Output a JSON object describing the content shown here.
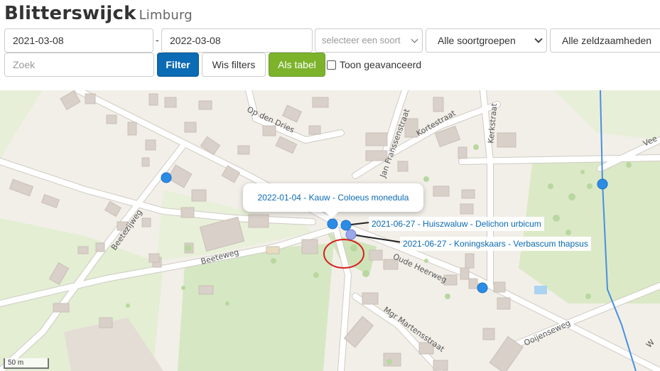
{
  "header": {
    "title": "Blitterswijck",
    "subtitle": "Limburg"
  },
  "filters": {
    "date_from": "2021-03-08",
    "date_separator": "-",
    "date_to": "2022-03-08",
    "species_placeholder": "selecteer een soort",
    "species_group": "Alle soortgroepen",
    "rarity": "Alle zeldzaamheden",
    "search_placeholder": "Zoek",
    "filter_label": "Filter",
    "clear_label": "Wis filters",
    "table_label": "Als tabel",
    "advanced_label": "Toon geavanceerd"
  },
  "map": {
    "popup": "2022-01-04 - Kauw - Coloeus monedula",
    "label_1": "2021-06-27 - Huiszwaluw - Delichon urbicum",
    "label_2": "2021-06-27 - Koningskaars - Verbascum thapsus",
    "scale": "50 m",
    "streets": {
      "op_den_dries": "Op den Dries",
      "jan_franssenstraat": "Jan Franssenstraat",
      "kortestraat": "Kortestraat",
      "kerkstraat": "Kerkstraat",
      "beetezijweg": "Beetezijweg",
      "beeteweg": "Beeteweg",
      "oude_heerweg": "Oude Heerweg",
      "mgr_martensstraat": "Mgr Martensstraat",
      "ooijenseweg": "Ooijenseweg",
      "vee": "Vee",
      "w": "W"
    },
    "colors": {
      "marker": "#2b8ce6",
      "marker_light": "#9aa8e8",
      "water": "#4a8fe0",
      "circle": "#d42020",
      "road": "#ffffff",
      "building": "#d9d0c9",
      "green": "#dbe9c6"
    }
  }
}
